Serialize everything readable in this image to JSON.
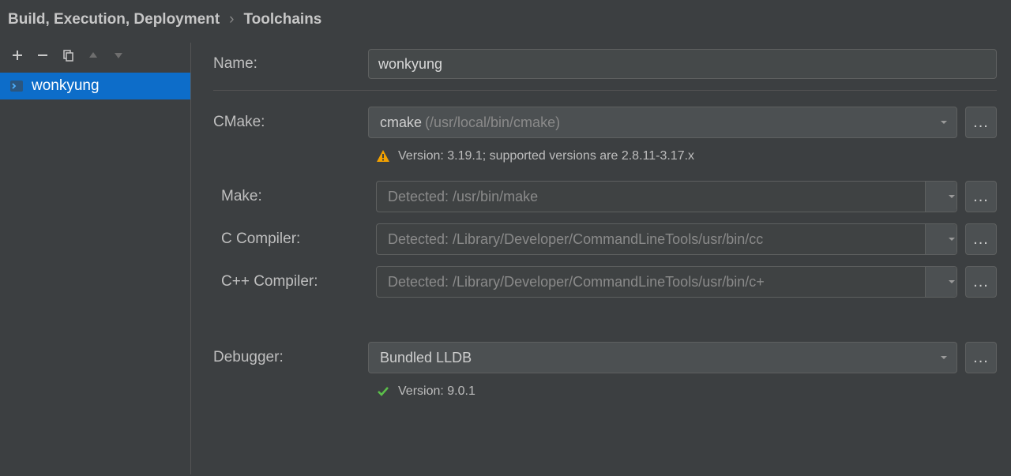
{
  "breadcrumb": {
    "parent": "Build, Execution, Deployment",
    "current": "Toolchains"
  },
  "sidebar": {
    "items": [
      {
        "label": "wonkyung",
        "selected": true
      }
    ]
  },
  "form": {
    "name_label": "Name:",
    "name_value": "wonkyung",
    "cmake_label": "CMake:",
    "cmake_value": "cmake",
    "cmake_hint": "(/usr/local/bin/cmake)",
    "cmake_status": "Version: 3.19.1; supported versions are 2.8.11-3.17.x",
    "make_label": "Make:",
    "make_placeholder": "Detected: /usr/bin/make",
    "ccompiler_label": "C Compiler:",
    "ccompiler_placeholder": "Detected: /Library/Developer/CommandLineTools/usr/bin/cc",
    "cxxcompiler_label": "C++ Compiler:",
    "cxxcompiler_placeholder": "Detected: /Library/Developer/CommandLineTools/usr/bin/c+",
    "debugger_label": "Debugger:",
    "debugger_value": "Bundled LLDB",
    "debugger_status": "Version: 9.0.1",
    "ellipsis": "..."
  }
}
